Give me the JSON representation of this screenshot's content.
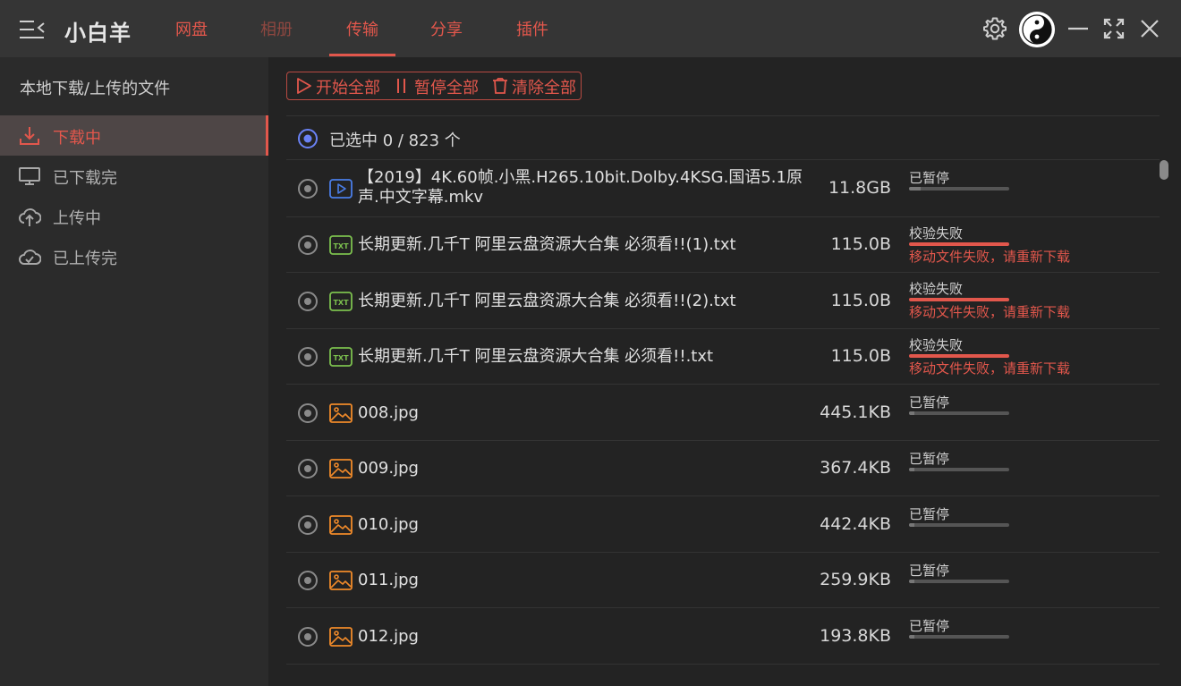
{
  "app": {
    "title": "小白羊"
  },
  "nav": {
    "tabs": [
      {
        "label": "网盘"
      },
      {
        "label": "相册"
      },
      {
        "label": "传输"
      },
      {
        "label": "分享"
      },
      {
        "label": "插件"
      }
    ],
    "active": "传输"
  },
  "sidebar": {
    "heading": "本地下载/上传的文件",
    "items": [
      {
        "label": "下载中"
      },
      {
        "label": "已下载完"
      },
      {
        "label": "上传中"
      },
      {
        "label": "已上传完"
      }
    ]
  },
  "toolbar": {
    "start_all": "开始全部",
    "pause_all": "暂停全部",
    "clear_all": "清除全部"
  },
  "selection": {
    "text": "已选中 0 / 823 个"
  },
  "files": [
    {
      "name": "【2019】4K.60帧.小黑.H265.10bit.Dolby.4KSG.国语5.1原声.中文字幕.mkv",
      "size": "11.8GB",
      "status": "已暂停",
      "error": "",
      "type": "video",
      "progress": 0.12
    },
    {
      "name": "长期更新.几千T 阿里云盘资源大合集 必须看!!(1).txt",
      "size": "115.0B",
      "status": "校验失败",
      "error": "移动文件失败，请重新下载",
      "type": "txt",
      "progress": 1
    },
    {
      "name": "长期更新.几千T 阿里云盘资源大合集 必须看!!(2).txt",
      "size": "115.0B",
      "status": "校验失败",
      "error": "移动文件失败，请重新下载",
      "type": "txt",
      "progress": 1
    },
    {
      "name": "长期更新.几千T 阿里云盘资源大合集 必须看!!.txt",
      "size": "115.0B",
      "status": "校验失败",
      "error": "移动文件失败，请重新下载",
      "type": "txt",
      "progress": 1
    },
    {
      "name": "008.jpg",
      "size": "445.1KB",
      "status": "已暂停",
      "error": "",
      "type": "image",
      "progress": 0.05
    },
    {
      "name": "009.jpg",
      "size": "367.4KB",
      "status": "已暂停",
      "error": "",
      "type": "image",
      "progress": 0.05
    },
    {
      "name": "010.jpg",
      "size": "442.4KB",
      "status": "已暂停",
      "error": "",
      "type": "image",
      "progress": 0.05
    },
    {
      "name": "011.jpg",
      "size": "259.9KB",
      "status": "已暂停",
      "error": "",
      "type": "image",
      "progress": 0.05
    },
    {
      "name": "012.jpg",
      "size": "193.8KB",
      "status": "已暂停",
      "error": "",
      "type": "image",
      "progress": 0.05
    }
  ],
  "icons": {
    "menu": "menu-collapse-icon",
    "settings": "gear-icon",
    "avatar": "yin-yang-avatar",
    "minimize": "minimize-icon",
    "fullscreen": "fullscreen-icon",
    "close": "close-icon",
    "download": "download-icon",
    "downloaded": "monitor-icon",
    "upload": "cloud-upload-icon",
    "uploaded": "cloud-check-icon",
    "radio": "radio-icon",
    "video": "video-file-icon",
    "txt": "txt-file-icon",
    "image": "image-file-icon"
  },
  "colors": {
    "accent": "#e2574c",
    "topbar": "#353535",
    "sidebar": "#2b2b2b",
    "main": "#232323",
    "video_icon": "#4a7ee8",
    "txt_icon": "#7cc04e",
    "image_icon": "#f08a2a",
    "selection_radio": "#6a82f5"
  }
}
